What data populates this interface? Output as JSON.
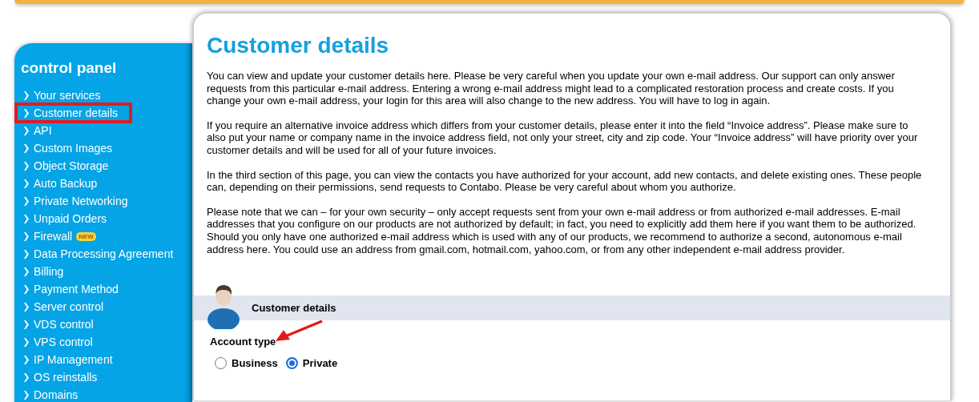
{
  "sidebar": {
    "title": "control panel",
    "items": [
      {
        "label": "Your services",
        "highlighted": false
      },
      {
        "label": "Customer details",
        "highlighted": true
      },
      {
        "label": "API",
        "highlighted": false
      },
      {
        "label": "Custom Images",
        "highlighted": false
      },
      {
        "label": "Object Storage",
        "highlighted": false
      },
      {
        "label": "Auto Backup",
        "highlighted": false
      },
      {
        "label": "Private Networking",
        "highlighted": false
      },
      {
        "label": "Unpaid Orders",
        "highlighted": false
      },
      {
        "label": "Firewall",
        "highlighted": false,
        "badge": "NEW"
      },
      {
        "label": "Data Processing Agreement",
        "highlighted": false
      },
      {
        "label": "Billing",
        "highlighted": false
      },
      {
        "label": "Payment Method",
        "highlighted": false
      },
      {
        "label": "Server control",
        "highlighted": false
      },
      {
        "label": "VDS control",
        "highlighted": false
      },
      {
        "label": "VPS control",
        "highlighted": false
      },
      {
        "label": "IP Management",
        "highlighted": false
      },
      {
        "label": "OS reinstalls",
        "highlighted": false
      },
      {
        "label": "Domains",
        "highlighted": false
      }
    ]
  },
  "main": {
    "title": "Customer details",
    "paragraphs": [
      "You can view and update your customer details here. Please be very careful when you update your own e-mail address. Our support can only answer requests from this particular e-mail address. Entering a wrong e-mail address might lead to a complicated restoration process and create costs. If you change your own e-mail address, your login for this area will also change to the new address. You will have to log in again.",
      "If you require an alternative invoice address which differs from your customer details, please enter it into the field “Invoice address”. Please make sure to also put your name or company name in the invoice address field, not only your street, city and zip code. Your “Invoice address” will have priority over your customer details and will be used for all of your future invoices.",
      "In the third section of this page, you can view the contacts you have authorized for your account, add new contacts, and delete existing ones. These people can, depending on their permissions, send requests to Contabo. Please be very careful about whom you authorize.",
      "Please note that we can – for your own security – only accept requests sent from your own e-mail address or from authorized e-mail addresses. E-mail addresses that you configure on our products are not authorized by default; in fact, you need to explicitly add them here if you want them to be authorized. Should you only have one authorized e-mail address which is used with any of our products, we recommend to authorize a second, autonomous e-mail address here. You could use an address from gmail.com, hotmail.com, yahoo.com, or from any other independent e-mail address provider."
    ],
    "section": {
      "title": "Customer details",
      "field_label": "Account type",
      "options": [
        {
          "label": "Business",
          "selected": false
        },
        {
          "label": "Private",
          "selected": true
        }
      ]
    }
  }
}
